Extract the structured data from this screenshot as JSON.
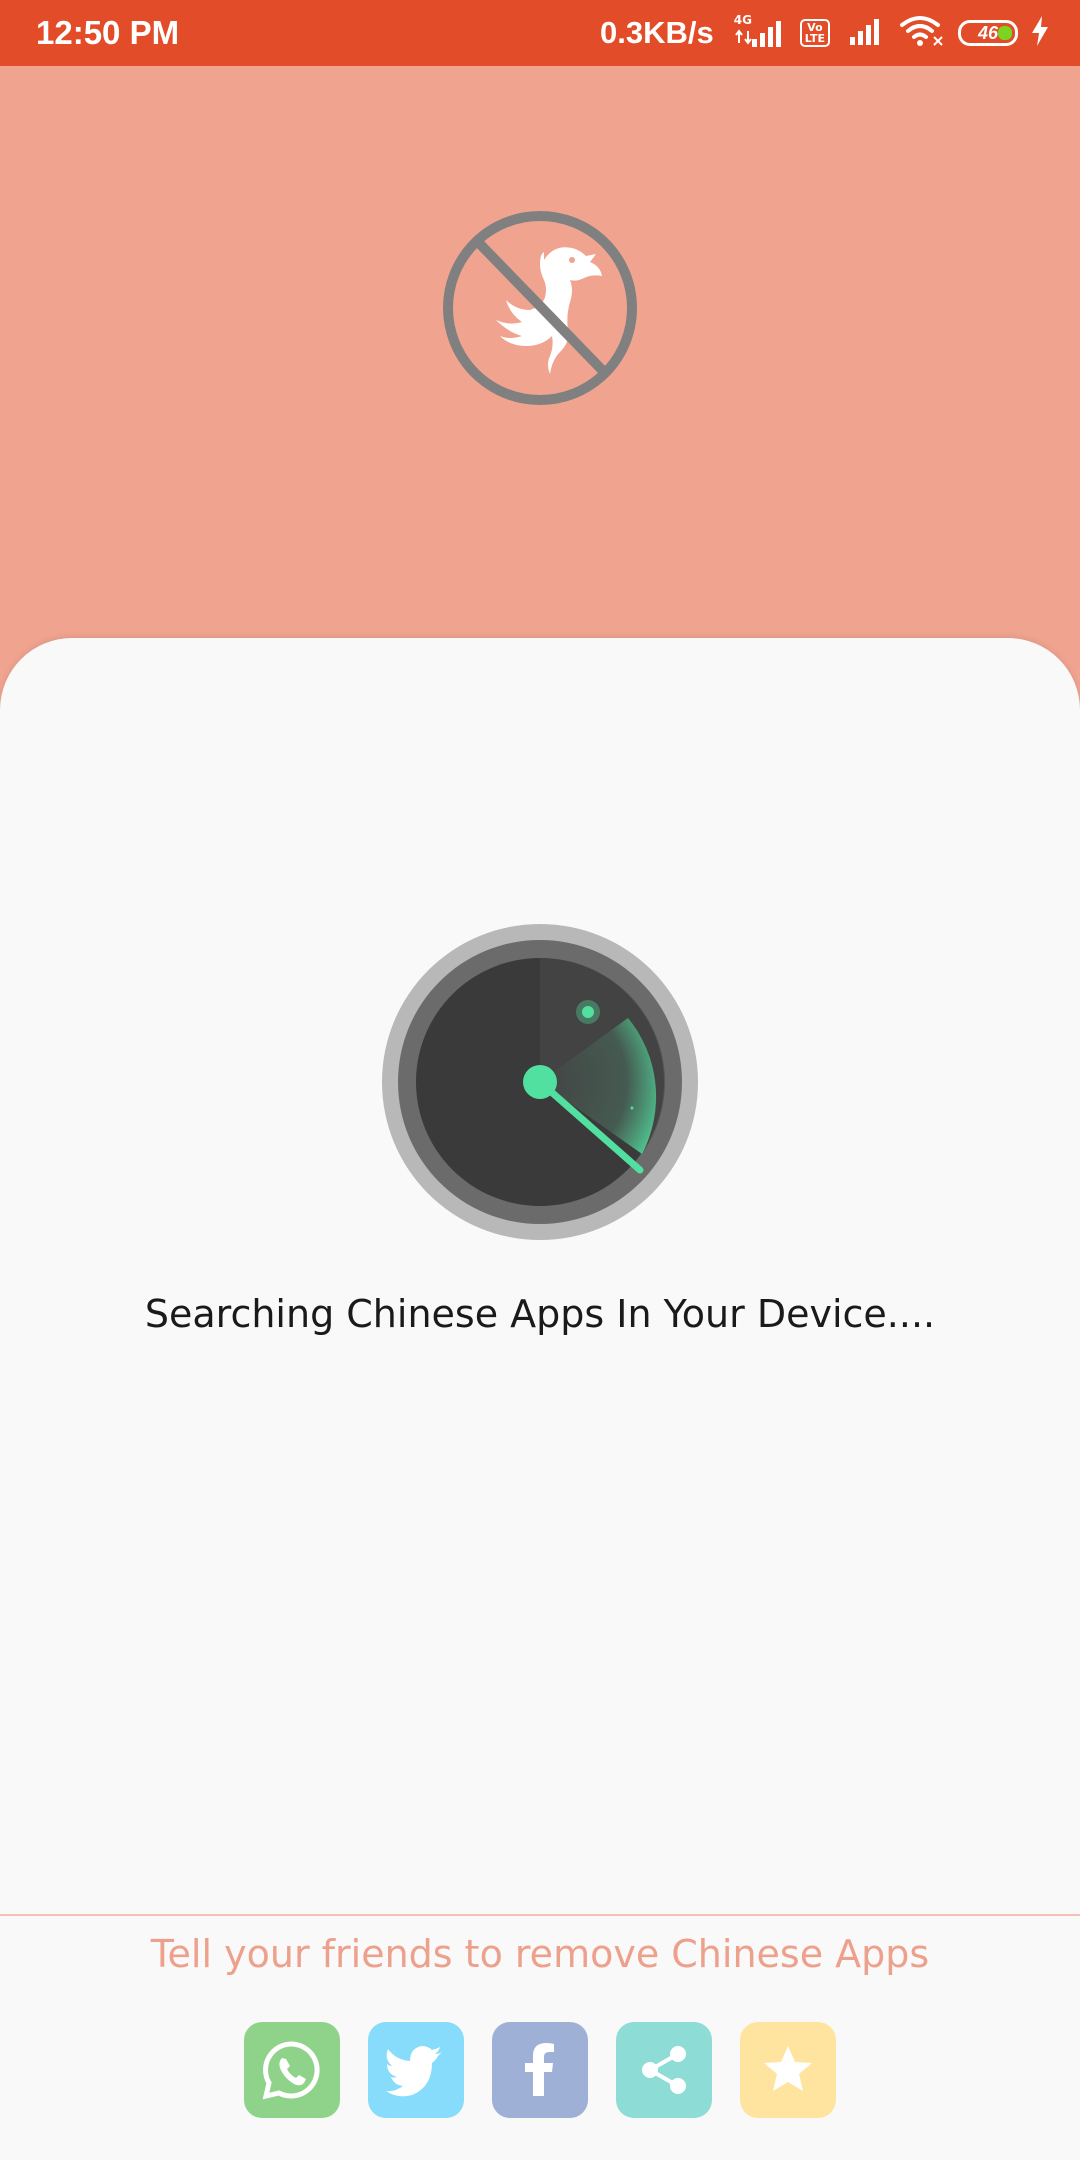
{
  "status_bar": {
    "time": "12:50 PM",
    "net_speed": "0.3KB/s",
    "network_type": "4G",
    "volte_line1": "Vo",
    "volte_line2": "LTE",
    "battery_level": "46",
    "icons": [
      "signal-icon",
      "volte-icon",
      "wifi-icon",
      "battery-icon",
      "charging-icon"
    ]
  },
  "header": {
    "logo_icon": "no-chinese-dragon-icon"
  },
  "main": {
    "radar_icon": "radar-scan-icon",
    "status_text": "Searching Chinese Apps In Your Device...."
  },
  "footer": {
    "share_text": "Tell your friends to remove Chinese Apps",
    "buttons": [
      {
        "name": "whatsapp",
        "icon": "whatsapp-icon",
        "color": "#8fd38a"
      },
      {
        "name": "twitter",
        "icon": "twitter-icon",
        "color": "#86dcfa"
      },
      {
        "name": "facebook",
        "icon": "facebook-icon",
        "color": "#9fb0d6"
      },
      {
        "name": "share",
        "icon": "share-icon",
        "color": "#8edcd6"
      },
      {
        "name": "rate",
        "icon": "star-icon",
        "color": "#ffe4a0"
      }
    ]
  },
  "colors": {
    "status_bar": "#e24c28",
    "header_bg": "#f0a490",
    "card_bg": "#f9f9f9",
    "radar_accent": "#52e0a0",
    "share_text": "#eda08c"
  }
}
